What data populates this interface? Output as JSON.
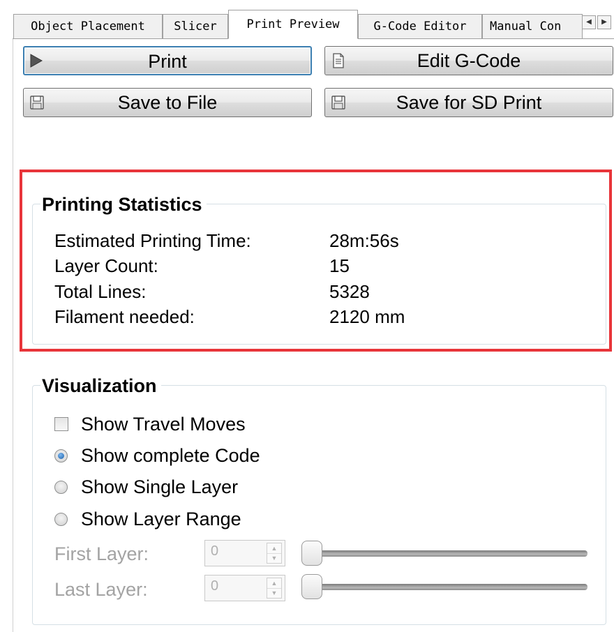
{
  "tabs": [
    {
      "label": "Object Placement",
      "active": false
    },
    {
      "label": "Slicer",
      "active": false
    },
    {
      "label": "Print Preview",
      "active": true
    },
    {
      "label": "G-Code Editor",
      "active": false
    },
    {
      "label": "Manual Con",
      "active": false
    }
  ],
  "buttons": {
    "print": "Print",
    "edit_gcode": "Edit G-Code",
    "save_to_file": "Save to File",
    "save_sd": "Save for SD Print"
  },
  "stats": {
    "title": "Printing Statistics",
    "rows": [
      {
        "label": "Estimated Printing Time:",
        "value": "28m:56s"
      },
      {
        "label": "Layer Count:",
        "value": "15"
      },
      {
        "label": "Total Lines:",
        "value": "5328"
      },
      {
        "label": "Filament needed:",
        "value": "2120 mm"
      }
    ]
  },
  "visualization": {
    "title": "Visualization",
    "show_travel_moves": {
      "label": "Show Travel Moves",
      "checked": false
    },
    "options": [
      {
        "label": "Show complete Code",
        "checked": true
      },
      {
        "label": "Show Single Layer",
        "checked": false
      },
      {
        "label": "Show Layer Range",
        "checked": false
      }
    ],
    "first_layer": {
      "label": "First Layer:",
      "value": "0"
    },
    "last_layer": {
      "label": "Last Layer:",
      "value": "0"
    }
  },
  "colors": {
    "highlight": "#e8353a",
    "focus_border": "#3c7fb1",
    "disabled_text": "#a3a3a3"
  },
  "icons": {
    "print": "play-icon",
    "edit_gcode": "document-icon",
    "save_to_file": "floppy-disk-icon",
    "save_sd": "floppy-disk-icon"
  }
}
